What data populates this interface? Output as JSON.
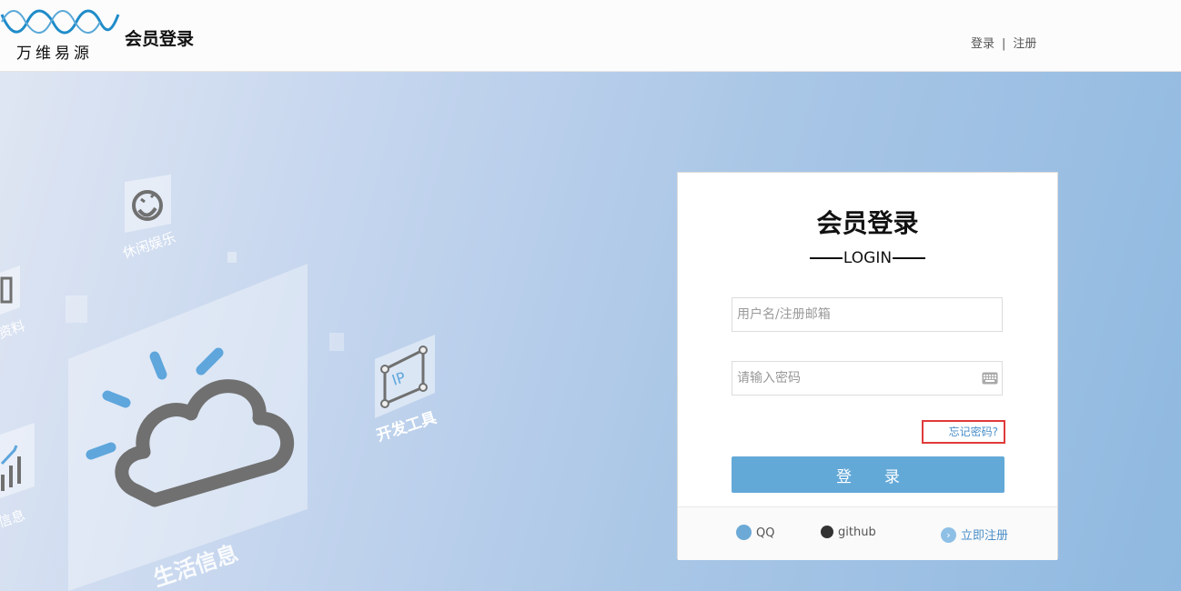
{
  "header": {
    "logo_text": "万维易源",
    "title": "会员登录",
    "links": {
      "login": "登录",
      "separator": "|",
      "register": "注册"
    }
  },
  "hero": {
    "tiles": {
      "entertainment": "休闲娱乐",
      "life_info": "生活信息",
      "dev_tools": "开发工具",
      "data": "资料",
      "info_partial": "信息",
      "ip_badge": "IP"
    }
  },
  "login": {
    "title": "会员登录",
    "subtitle": "LOGIN",
    "username_placeholder": "用户名/注册邮箱",
    "password_placeholder": "请输入密码",
    "forgot_label": "忘记密码?",
    "submit_label": "登录",
    "footer": {
      "qq": "QQ",
      "github": "github",
      "register": "立即注册"
    }
  },
  "colors": {
    "accent": "#63a9d8",
    "link": "#4a8fc8",
    "highlight_border": "#e03a3a",
    "logo_blue": "#1f8cc9"
  },
  "icons": [
    "logo-waves-icon",
    "keyboard-icon",
    "qq-icon",
    "github-icon",
    "arrow-right-circle-icon",
    "smile-icon",
    "cloud-sun-icon",
    "ip-tool-icon",
    "chart-icon"
  ]
}
